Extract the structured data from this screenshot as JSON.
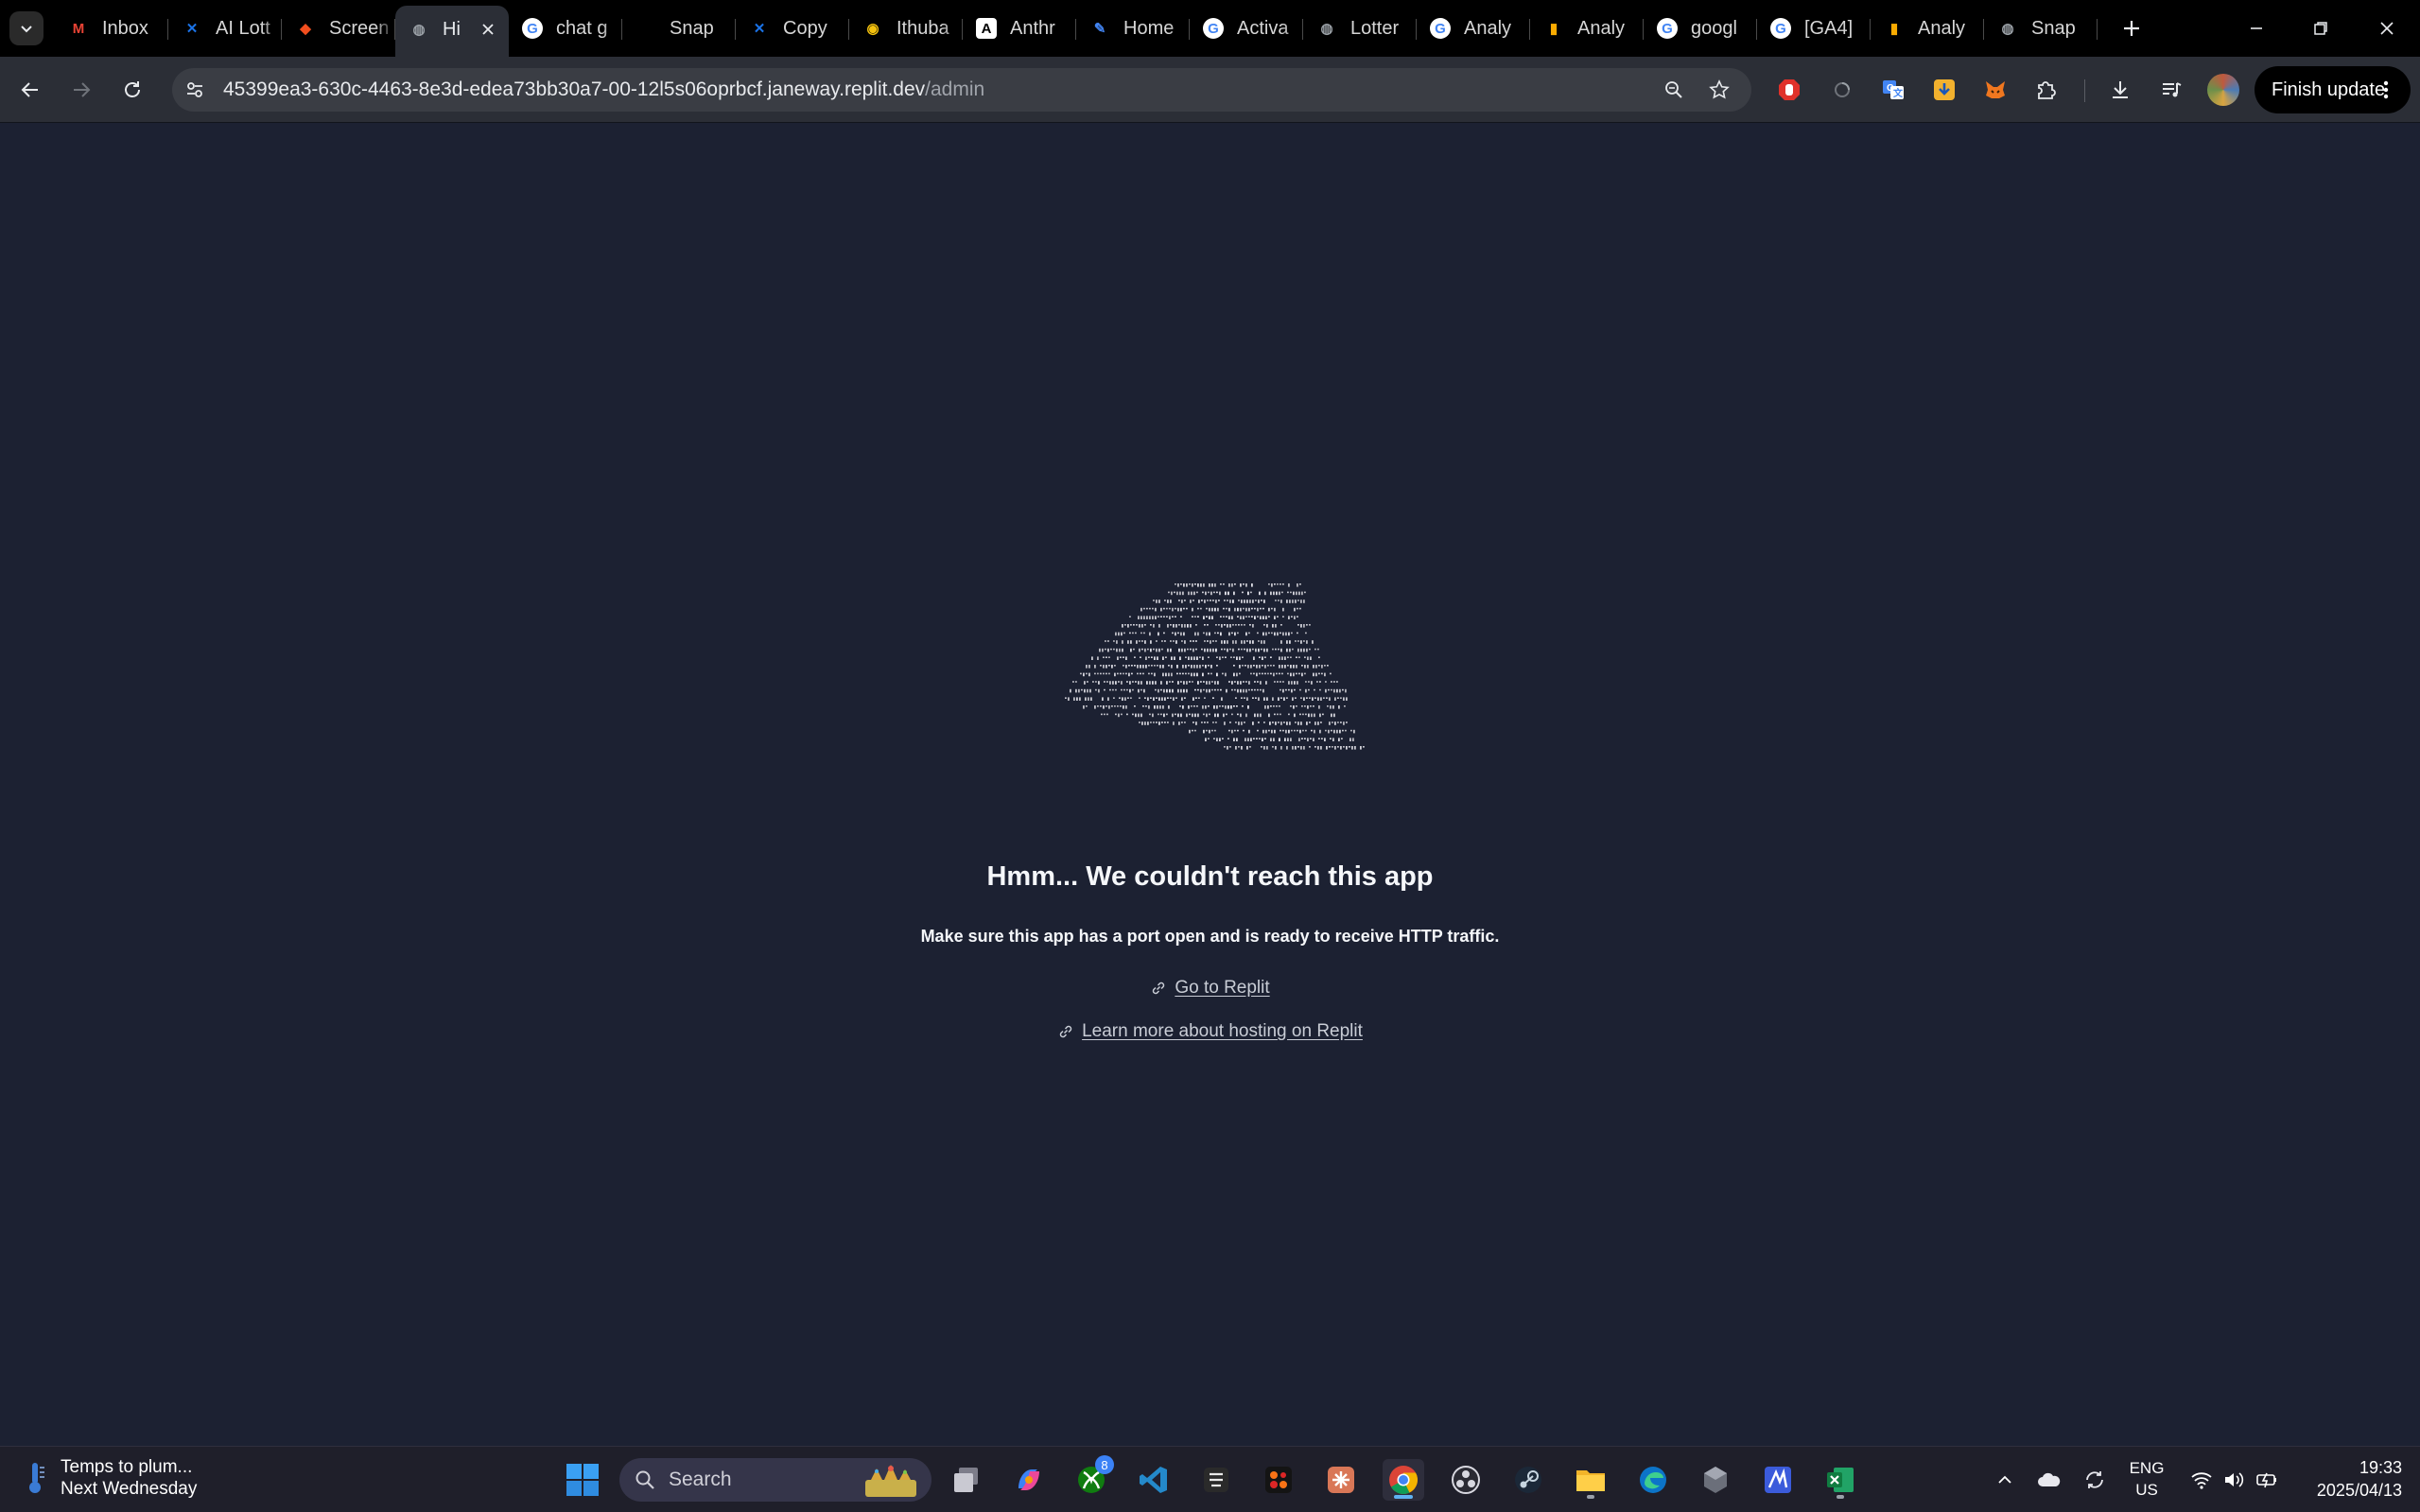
{
  "browser": {
    "tabs": [
      {
        "title": "Inbox",
        "favicon": "gmail-icon",
        "color": "#ea4335"
      },
      {
        "title": "AI Lott",
        "favicon": "butterfly-icon",
        "color": "#1a73e8"
      },
      {
        "title": "Screen",
        "favicon": "figma-icon",
        "color": "#f24e1e"
      },
      {
        "title": "Hi",
        "favicon": "globe-icon",
        "color": "#9aa0a6",
        "active": true
      },
      {
        "title": "chat g",
        "favicon": "google-icon",
        "color": "#ffffff"
      },
      {
        "title": "Snap",
        "favicon": "blank-icon",
        "color": "#000000"
      },
      {
        "title": "Copy",
        "favicon": "butterfly-icon",
        "color": "#1a73e8"
      },
      {
        "title": "Ithuba",
        "favicon": "ithuba-icon",
        "color": "#f4c20d"
      },
      {
        "title": "Anthr",
        "favicon": "anthropic-icon",
        "color": "#ffffff"
      },
      {
        "title": "Home",
        "favicon": "pen-icon",
        "color": "#4285f4"
      },
      {
        "title": "Activa",
        "favicon": "google-icon",
        "color": "#ffffff"
      },
      {
        "title": "Lotter",
        "favicon": "globe-icon",
        "color": "#9aa0a6"
      },
      {
        "title": "Analy",
        "favicon": "google-icon",
        "color": "#ffffff"
      },
      {
        "title": "Analy",
        "favicon": "analytics-icon",
        "color": "#f9ab00"
      },
      {
        "title": "googl",
        "favicon": "google-icon",
        "color": "#ffffff"
      },
      {
        "title": "[GA4]",
        "favicon": "google-icon",
        "color": "#ffffff"
      },
      {
        "title": "Analy",
        "favicon": "analytics-icon",
        "color": "#f9ab00"
      },
      {
        "title": "Snap",
        "favicon": "globe-icon",
        "color": "#9aa0a6"
      }
    ],
    "url_host": "45399ea3-630c-4463-8e3d-edea73bb30a7-00-12l5s06oprbcf.janeway.replit.dev",
    "url_path": "/admin",
    "finish_update_label": "Finish update"
  },
  "page": {
    "headline": "Hmm... We couldn't reach this app",
    "subline": "Make sure this app has a port open and is ready to receive HTTP traffic.",
    "link_replit": "Go to Replit",
    "link_hosting": "Learn more about hosting on Replit"
  },
  "taskbar": {
    "weather_title": "Temps to plum...",
    "weather_sub": "Next Wednesday",
    "search_placeholder": "Search",
    "xbox_badge": "8",
    "lang_line1": "ENG",
    "lang_line2": "US",
    "time": "19:33",
    "date": "2025/04/13"
  }
}
